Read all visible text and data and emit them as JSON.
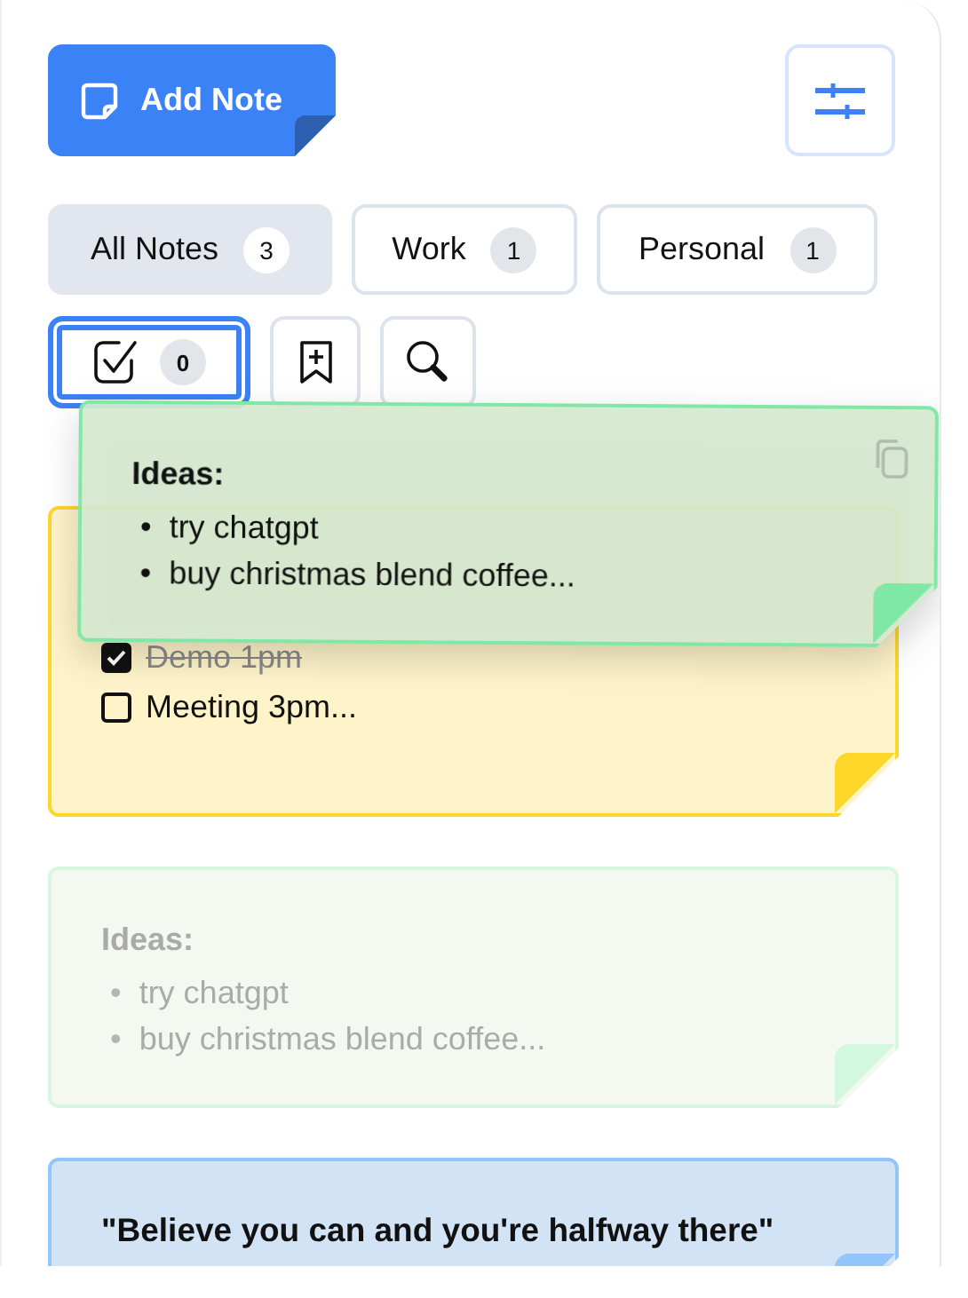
{
  "toolbar": {
    "add_button": "Add Note"
  },
  "filters": [
    {
      "label": "All Notes",
      "count": "3",
      "selected": true
    },
    {
      "label": "Work",
      "count": "1",
      "selected": false
    },
    {
      "label": "Personal",
      "count": "1",
      "selected": false
    }
  ],
  "tools": [
    {
      "kind": "checklist",
      "count": "0",
      "selected": true
    },
    {
      "kind": "bookmark-add",
      "selected": false
    },
    {
      "kind": "search",
      "selected": false
    }
  ],
  "notes": [
    {
      "kind": "checklist",
      "color": "#fcd72a",
      "dragging": false,
      "items": [
        {
          "text": "Demo 1pm",
          "checked": true
        },
        {
          "text": "Meeting 3pm...",
          "checked": false
        }
      ]
    },
    {
      "kind": "list",
      "color": "#d4f7df",
      "dragging": true,
      "title": "Ideas:",
      "items": [
        {
          "bullet": "•",
          "text": "try chatgpt"
        },
        {
          "bullet": "•",
          "text": "buy christmas blend coffee..."
        }
      ]
    },
    {
      "kind": "quote",
      "color": "#93c5fd",
      "dragging": false,
      "title": "\"Believe you can and you're halfway there\""
    }
  ],
  "drag_preview": {
    "kind": "list",
    "color": "#7fe8a6",
    "title": "Ideas:",
    "items": [
      {
        "bullet": "•",
        "text": "try chatgpt"
      },
      {
        "bullet": "•",
        "text": "buy christmas blend coffee..."
      }
    ]
  }
}
